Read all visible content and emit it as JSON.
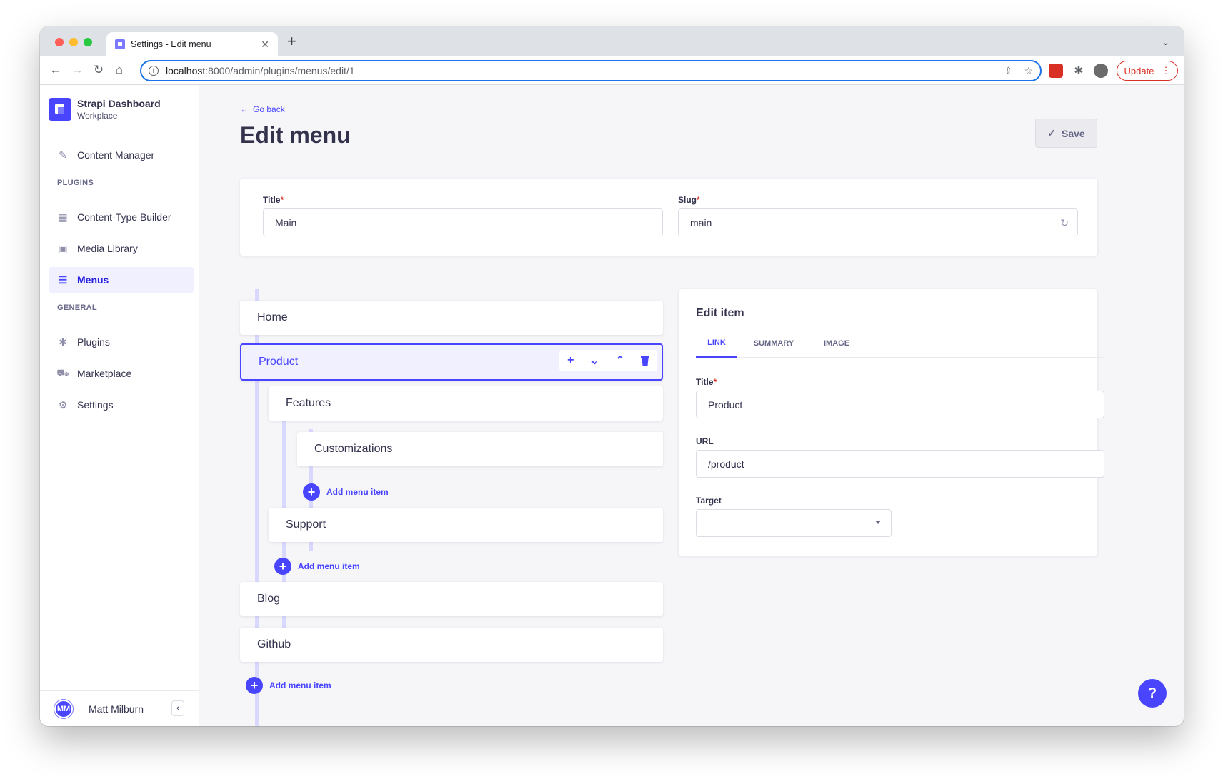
{
  "browser": {
    "tab_title": "Settings - Edit menu",
    "url_host": "localhost",
    "url_path": ":8000/admin/plugins/menus/edit/1",
    "update_label": "Update"
  },
  "brand": {
    "title": "Strapi Dashboard",
    "subtitle": "Workplace"
  },
  "sidebar": {
    "content_manager": "Content Manager",
    "plugins_heading": "PLUGINS",
    "plugins": [
      "Content-Type Builder",
      "Media Library",
      "Menus"
    ],
    "general_heading": "GENERAL",
    "general": [
      "Plugins",
      "Marketplace",
      "Settings"
    ],
    "user_initials": "MM",
    "user_name": "Matt Milburn"
  },
  "header": {
    "go_back": "Go back",
    "title": "Edit menu",
    "save_label": "Save"
  },
  "menu_form": {
    "title_label": "Title",
    "title_value": "Main",
    "slug_label": "Slug",
    "slug_value": "main"
  },
  "tree": {
    "home": "Home",
    "product": "Product",
    "features": "Features",
    "customizations": "Customizations",
    "support": "Support",
    "blog": "Blog",
    "github": "Github",
    "add_label": "Add menu item"
  },
  "edit_item": {
    "heading": "Edit item",
    "tabs": [
      "LINK",
      "SUMMARY",
      "IMAGE"
    ],
    "title_label": "Title",
    "title_value": "Product",
    "url_label": "URL",
    "url_value": "/product",
    "target_label": "Target",
    "target_value": ""
  },
  "colors": {
    "primary": "#4945ff",
    "danger": "#d02b20",
    "background": "#f6f6f9"
  }
}
